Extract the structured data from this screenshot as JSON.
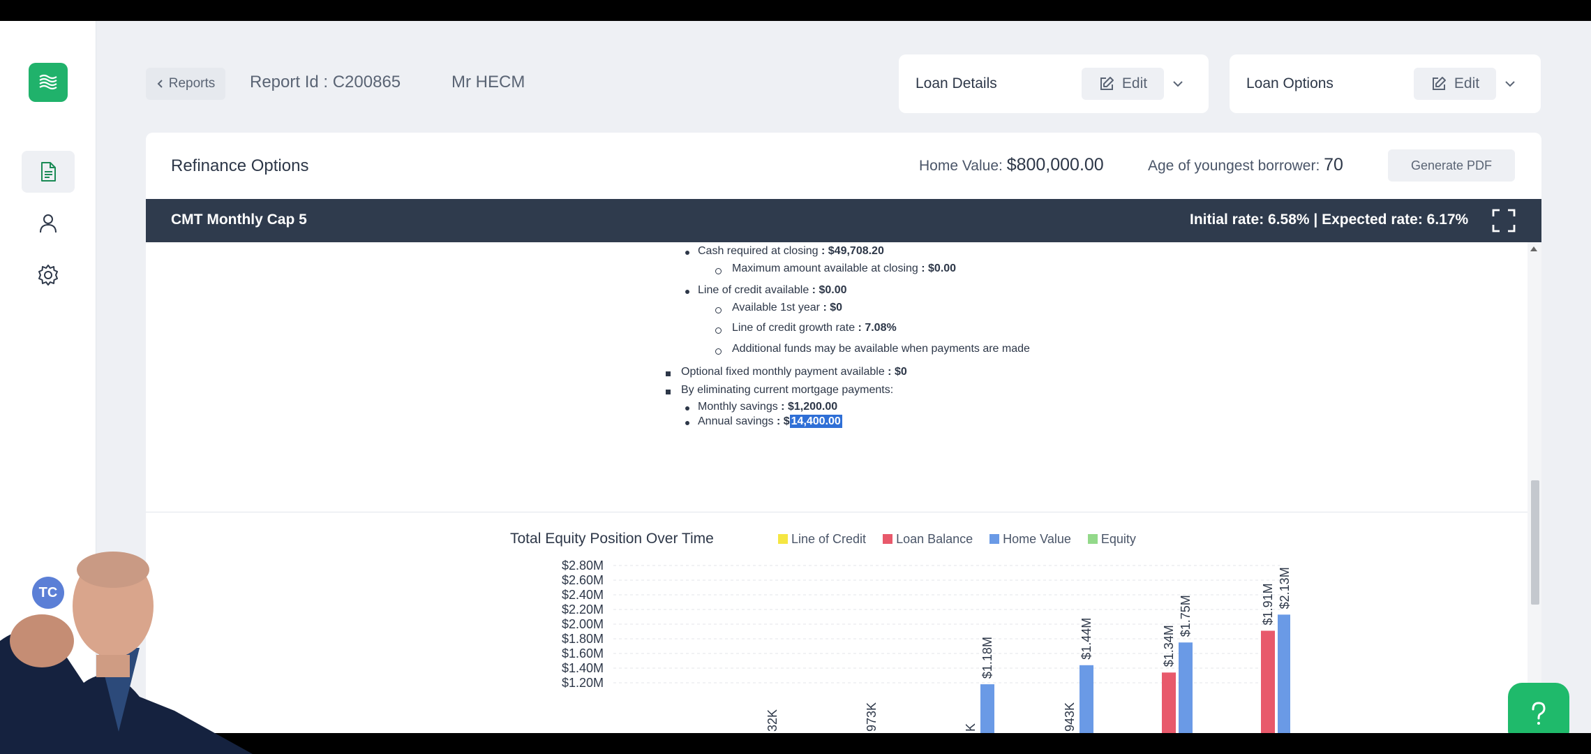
{
  "topbar": {
    "back_label": "Reports",
    "report_id": "Report Id : C200865",
    "borrower": "Mr HECM",
    "loan_details": {
      "label": "Loan Details",
      "edit": "Edit"
    },
    "loan_options": {
      "label": "Loan Options",
      "edit": "Edit"
    }
  },
  "sidebar": {
    "avatar_initials": "TC",
    "items": [
      {
        "icon": "document-icon",
        "active": true
      },
      {
        "icon": "user-icon",
        "active": false
      },
      {
        "icon": "gear-icon",
        "active": false
      }
    ]
  },
  "panel": {
    "title": "Refinance Options",
    "home_value_label": "Home Value:",
    "home_value": "$800,000.00",
    "age_label": "Age of youngest borrower:",
    "age": "70",
    "generate_pdf": "Generate PDF",
    "program": "CMT Monthly Cap 5",
    "rates": "Initial rate: 6.58% | Expected rate: 6.17%"
  },
  "details": {
    "cash_required_label": "Cash required at closing",
    "cash_required_value": ": $49,708.20",
    "max_available_label": "Maximum amount available at closing",
    "max_available_value": ": $0.00",
    "loc_label": "Line of credit available",
    "loc_value": ": $0.00",
    "first_year_label": "Available 1st year",
    "first_year_value": ": $0",
    "growth_label": "Line of credit growth rate",
    "growth_value": ": 7.08%",
    "additional_funds": "Additional funds may be available when payments are made",
    "optional_payment_label": "Optional fixed monthly payment available",
    "optional_payment_value": ": $0",
    "eliminating": "By eliminating current mortgage payments:",
    "monthly_savings_label": "Monthly savings",
    "monthly_savings_value": ": $1,200.00",
    "annual_savings_label": "Annual savings",
    "annual_savings_prefix": ": $",
    "annual_savings_highlight": "14,400.00"
  },
  "chart_data": {
    "type": "bar",
    "title": "Total Equity Position Over Time",
    "legend": [
      {
        "name": "Line of Credit",
        "color": "#f5e642"
      },
      {
        "name": "Loan Balance",
        "color": "#e8596b"
      },
      {
        "name": "Home Value",
        "color": "#6a9ae6"
      },
      {
        "name": "Equity",
        "color": "#93d98a"
      }
    ],
    "y_ticks": [
      "$2.80M",
      "$2.60M",
      "$2.40M",
      "$2.20M",
      "$2.00M",
      "$1.80M",
      "$1.60M",
      "$1.40M",
      "$1.20M"
    ],
    "ylim_visible": [
      1.2,
      2.8
    ],
    "groups": [
      {
        "loan_balance_label": "32K",
        "loan_balance": null,
        "home_value": null,
        "home_value_label": ""
      },
      {
        "loan_balance_label": "973K",
        "loan_balance": null,
        "home_value": null,
        "home_value_label": ""
      },
      {
        "loan_balance_label": "K",
        "loan_balance": null,
        "home_value": 1.18,
        "home_value_label": "$1.18M"
      },
      {
        "loan_balance_label": "943K",
        "loan_balance": null,
        "home_value": 1.44,
        "home_value_label": "$1.44M"
      },
      {
        "loan_balance_label": "$1.34M",
        "loan_balance": 1.34,
        "home_value": 1.75,
        "home_value_label": "$1.75M"
      },
      {
        "loan_balance_label": "$1.91M",
        "loan_balance": 1.91,
        "home_value": 2.13,
        "home_value_label": "$2.13M"
      }
    ]
  },
  "colors": {
    "accent_green": "#1fba6b",
    "dark_bar": "#2f3b4d",
    "highlight": "#2f6fd6"
  }
}
